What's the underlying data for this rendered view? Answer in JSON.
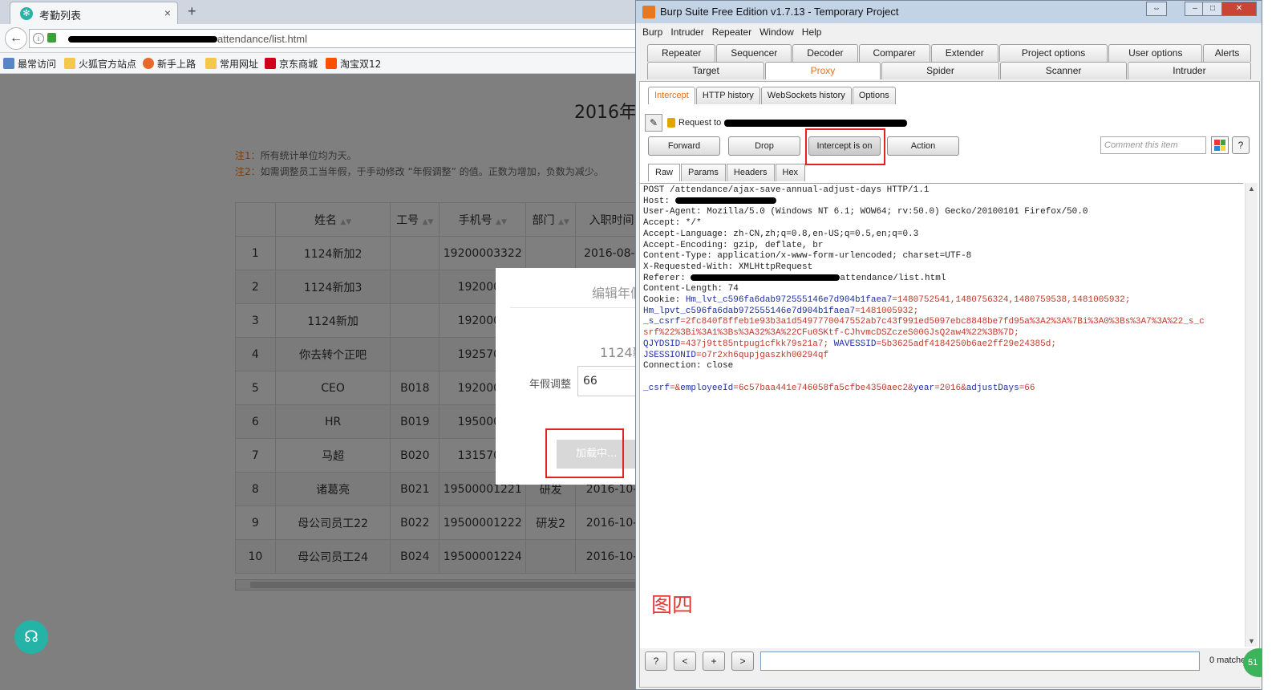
{
  "firefox": {
    "tab_title": "考勤列表",
    "tab_close": "×",
    "new_tab": "+",
    "url_path": "attendance/list.html",
    "bookmarks": [
      "最常访问",
      "火狐官方站点",
      "新手上路",
      "常用网址",
      "京东商城",
      "淘宝双12"
    ],
    "page_title": "2016年",
    "note1_key": "注1：",
    "note1_text": "所有统计单位均为天。",
    "note2_key": "注2：",
    "note2_text": "如需调整员工当年假，于手动修改 “年假调整” 的值。正数为增加，负数为减少。",
    "table": {
      "headers": [
        "",
        "姓名",
        "工号",
        "手机号",
        "部门",
        "入职时间"
      ],
      "rows": [
        [
          "1",
          "1124新加2",
          "",
          "19200003322",
          "",
          "2016-08-("
        ],
        [
          "2",
          "1124新加3",
          "",
          "1920000",
          "",
          ""
        ],
        [
          "3",
          "1124新加",
          "",
          "1920000",
          "",
          ""
        ],
        [
          "4",
          "你去转个正吧",
          "",
          "1925704",
          "",
          ""
        ],
        [
          "5",
          "CEO",
          "B018",
          "1920000",
          "",
          ""
        ],
        [
          "6",
          "HR",
          "B019",
          "1950000",
          "",
          ""
        ],
        [
          "7",
          "马超",
          "B020",
          "1315704",
          "",
          ""
        ],
        [
          "8",
          "诸葛亮",
          "B021",
          "19500001221",
          "研发",
          "2016-10-"
        ],
        [
          "9",
          "母公司员工22",
          "B022",
          "19500001222",
          "研发2",
          "2016-10-"
        ],
        [
          "10",
          "母公司员工24",
          "B024",
          "19500001224",
          "",
          "2016-10-"
        ]
      ]
    },
    "modal": {
      "title": "编辑年假",
      "name": "1124新",
      "label": "年假调整",
      "value": "66",
      "button": "加载中..."
    }
  },
  "burp": {
    "window_title": "Burp Suite Free Edition v1.7.13 - Temporary Project",
    "menu": [
      "Burp",
      "Intruder",
      "Repeater",
      "Window",
      "Help"
    ],
    "tabs_row1": [
      "Repeater",
      "Sequencer",
      "Decoder",
      "Comparer",
      "Extender",
      "Project options",
      "User options",
      "Alerts"
    ],
    "tabs_row2": [
      "Target",
      "Proxy",
      "Spider",
      "Scanner",
      "Intruder"
    ],
    "subtabs": [
      "Intercept",
      "HTTP history",
      "WebSockets history",
      "Options"
    ],
    "request_to": "Request to",
    "buttons": {
      "forward": "Forward",
      "drop": "Drop",
      "intercept": "Intercept is on",
      "action": "Action"
    },
    "comment_placeholder": "Comment this item",
    "help": "?",
    "view_tabs": [
      "Raw",
      "Params",
      "Headers",
      "Hex"
    ],
    "request": {
      "line1": "POST /attendance/ajax-save-annual-adjust-days HTTP/1.1",
      "host": "Host: ",
      "user_agent": "User-Agent: Mozilla/5.0 (Windows NT 6.1; WOW64; rv:50.0) Gecko/20100101 Firefox/50.0",
      "accept": "Accept: */*",
      "accept_language": "Accept-Language: zh-CN,zh;q=0.8,en-US;q=0.5,en;q=0.3",
      "accept_encoding": "Accept-Encoding: gzip, deflate, br",
      "content_type": "Content-Type: application/x-www-form-urlencoded; charset=UTF-8",
      "x_requested_with": "X-Requested-With: XMLHttpRequest",
      "referer_label": "Referer: ",
      "referer_path": "attendance/list.html",
      "content_length": "Content-Length: 74",
      "cookie_label": "Cookie: ",
      "cookie_k1": "Hm_lvt_c596fa6dab972555146e7d904b1faea7",
      "cookie_v1": "=1480752541,1480756324,1480759538,1481005932;",
      "cookie_k2": "Hm_lpvt_c596fa6dab972555146e7d904b1faea7",
      "cookie_v2": "=1481005932;",
      "cookie_k3": "_s_csrf",
      "cookie_v3a": "=2fc840f8ffeb1e93b3a1d5497770047552ab7c43f991ed5097ebc8848be7fd95a%3A2%3A%7Bi%3A0%3Bs%3A7%3A%22_s_c",
      "cookie_v3b": "srf%22%3Bi%3A1%3Bs%3A32%3A%22CFu0SKtf-CJhvmcDSZczeS00GJsQ2aw4%22%3B%7D;",
      "cookie_k4": "QJYDSID",
      "cookie_v4": "=437j9tt85ntpug1cfkk79s21a7;",
      "cookie_k5": "WAVESSID",
      "cookie_v5": "=5b3625adf4184250b6ae2ff29e24385d;",
      "cookie_k6": "JSESSIONID",
      "cookie_v6": "=o7r2xh6qupjgaszkh00294qf",
      "connection": "Connection: close",
      "body_k1": "_csrf",
      "body_v1": "=&",
      "body_k2": "employeeId",
      "body_v2": "=6c57baa441e746058fa5cfbe4350aec2&",
      "body_k3": "year",
      "body_v3": "=2016&",
      "body_k4": "adjustDays",
      "body_v4": "=66"
    },
    "figure_label": "图四",
    "nav_buttons": [
      "?",
      "<",
      "+",
      ">"
    ],
    "matches": "0 matche"
  }
}
